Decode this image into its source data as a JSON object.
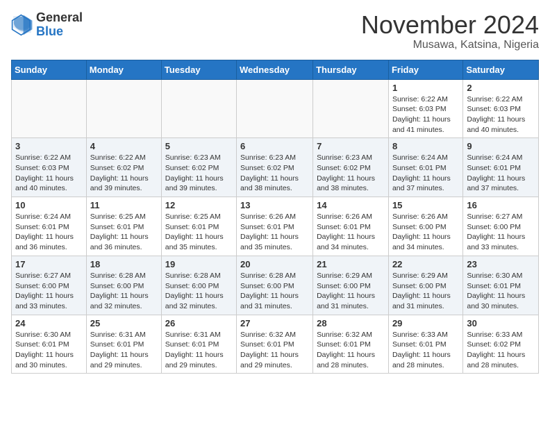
{
  "logo": {
    "general": "General",
    "blue": "Blue"
  },
  "title": "November 2024",
  "location": "Musawa, Katsina, Nigeria",
  "days_of_week": [
    "Sunday",
    "Monday",
    "Tuesday",
    "Wednesday",
    "Thursday",
    "Friday",
    "Saturday"
  ],
  "weeks": [
    [
      {
        "day": "",
        "info": ""
      },
      {
        "day": "",
        "info": ""
      },
      {
        "day": "",
        "info": ""
      },
      {
        "day": "",
        "info": ""
      },
      {
        "day": "",
        "info": ""
      },
      {
        "day": "1",
        "info": "Sunrise: 6:22 AM\nSunset: 6:03 PM\nDaylight: 11 hours and 41 minutes."
      },
      {
        "day": "2",
        "info": "Sunrise: 6:22 AM\nSunset: 6:03 PM\nDaylight: 11 hours and 40 minutes."
      }
    ],
    [
      {
        "day": "3",
        "info": "Sunrise: 6:22 AM\nSunset: 6:03 PM\nDaylight: 11 hours and 40 minutes."
      },
      {
        "day": "4",
        "info": "Sunrise: 6:22 AM\nSunset: 6:02 PM\nDaylight: 11 hours and 39 minutes."
      },
      {
        "day": "5",
        "info": "Sunrise: 6:23 AM\nSunset: 6:02 PM\nDaylight: 11 hours and 39 minutes."
      },
      {
        "day": "6",
        "info": "Sunrise: 6:23 AM\nSunset: 6:02 PM\nDaylight: 11 hours and 38 minutes."
      },
      {
        "day": "7",
        "info": "Sunrise: 6:23 AM\nSunset: 6:02 PM\nDaylight: 11 hours and 38 minutes."
      },
      {
        "day": "8",
        "info": "Sunrise: 6:24 AM\nSunset: 6:01 PM\nDaylight: 11 hours and 37 minutes."
      },
      {
        "day": "9",
        "info": "Sunrise: 6:24 AM\nSunset: 6:01 PM\nDaylight: 11 hours and 37 minutes."
      }
    ],
    [
      {
        "day": "10",
        "info": "Sunrise: 6:24 AM\nSunset: 6:01 PM\nDaylight: 11 hours and 36 minutes."
      },
      {
        "day": "11",
        "info": "Sunrise: 6:25 AM\nSunset: 6:01 PM\nDaylight: 11 hours and 36 minutes."
      },
      {
        "day": "12",
        "info": "Sunrise: 6:25 AM\nSunset: 6:01 PM\nDaylight: 11 hours and 35 minutes."
      },
      {
        "day": "13",
        "info": "Sunrise: 6:26 AM\nSunset: 6:01 PM\nDaylight: 11 hours and 35 minutes."
      },
      {
        "day": "14",
        "info": "Sunrise: 6:26 AM\nSunset: 6:01 PM\nDaylight: 11 hours and 34 minutes."
      },
      {
        "day": "15",
        "info": "Sunrise: 6:26 AM\nSunset: 6:00 PM\nDaylight: 11 hours and 34 minutes."
      },
      {
        "day": "16",
        "info": "Sunrise: 6:27 AM\nSunset: 6:00 PM\nDaylight: 11 hours and 33 minutes."
      }
    ],
    [
      {
        "day": "17",
        "info": "Sunrise: 6:27 AM\nSunset: 6:00 PM\nDaylight: 11 hours and 33 minutes."
      },
      {
        "day": "18",
        "info": "Sunrise: 6:28 AM\nSunset: 6:00 PM\nDaylight: 11 hours and 32 minutes."
      },
      {
        "day": "19",
        "info": "Sunrise: 6:28 AM\nSunset: 6:00 PM\nDaylight: 11 hours and 32 minutes."
      },
      {
        "day": "20",
        "info": "Sunrise: 6:28 AM\nSunset: 6:00 PM\nDaylight: 11 hours and 31 minutes."
      },
      {
        "day": "21",
        "info": "Sunrise: 6:29 AM\nSunset: 6:00 PM\nDaylight: 11 hours and 31 minutes."
      },
      {
        "day": "22",
        "info": "Sunrise: 6:29 AM\nSunset: 6:00 PM\nDaylight: 11 hours and 31 minutes."
      },
      {
        "day": "23",
        "info": "Sunrise: 6:30 AM\nSunset: 6:01 PM\nDaylight: 11 hours and 30 minutes."
      }
    ],
    [
      {
        "day": "24",
        "info": "Sunrise: 6:30 AM\nSunset: 6:01 PM\nDaylight: 11 hours and 30 minutes."
      },
      {
        "day": "25",
        "info": "Sunrise: 6:31 AM\nSunset: 6:01 PM\nDaylight: 11 hours and 29 minutes."
      },
      {
        "day": "26",
        "info": "Sunrise: 6:31 AM\nSunset: 6:01 PM\nDaylight: 11 hours and 29 minutes."
      },
      {
        "day": "27",
        "info": "Sunrise: 6:32 AM\nSunset: 6:01 PM\nDaylight: 11 hours and 29 minutes."
      },
      {
        "day": "28",
        "info": "Sunrise: 6:32 AM\nSunset: 6:01 PM\nDaylight: 11 hours and 28 minutes."
      },
      {
        "day": "29",
        "info": "Sunrise: 6:33 AM\nSunset: 6:01 PM\nDaylight: 11 hours and 28 minutes."
      },
      {
        "day": "30",
        "info": "Sunrise: 6:33 AM\nSunset: 6:02 PM\nDaylight: 11 hours and 28 minutes."
      }
    ]
  ]
}
